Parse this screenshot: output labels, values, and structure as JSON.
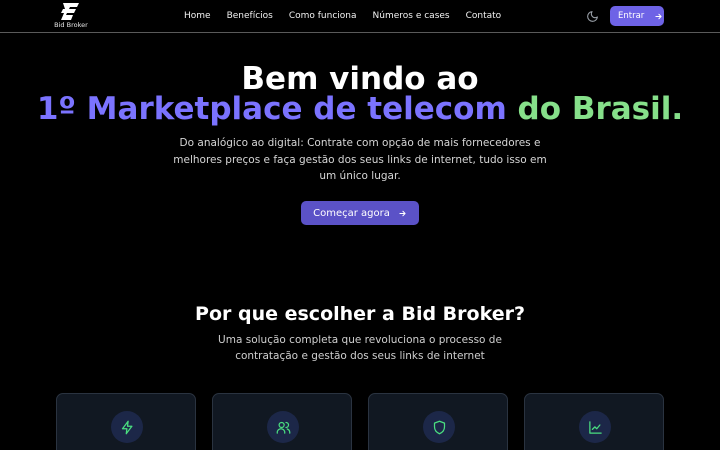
{
  "brand": {
    "name": "Bid Broker",
    "logo_icon": "bid-broker-logo"
  },
  "nav": {
    "links": [
      "Home",
      "Benefícios",
      "Como funciona",
      "Números e cases",
      "Contato"
    ],
    "theme_icon": "moon-icon",
    "login_label": "Entrar",
    "login_icon": "arrow-right-icon"
  },
  "hero": {
    "title_line1": "Bem vindo ao",
    "title_highlight": "1º Marketplace de telecom",
    "title_end": " do Brasil.",
    "description": "Do analógico ao digital: Contrate com opção de mais fornecedores e melhores preços e faça gestão dos seus links de internet, tudo isso em um único lugar.",
    "cta_label": "Começar agora",
    "cta_icon": "arrow-right-icon"
  },
  "why": {
    "title": "Por que escolher a Bid Broker?",
    "description": "Uma solução completa que revoluciona o processo de contratação e gestão dos seus links de internet"
  },
  "features": [
    {
      "icon": "lightning-icon"
    },
    {
      "icon": "users-icon"
    },
    {
      "icon": "shield-icon"
    },
    {
      "icon": "chart-line-icon"
    }
  ],
  "colors": {
    "accent": "#6e63e6",
    "cta": "#5b52c7",
    "highlight_purple": "#7b73ff",
    "highlight_green": "#86e08a",
    "icon_green": "#4ade80",
    "card_bg": "#111822"
  }
}
